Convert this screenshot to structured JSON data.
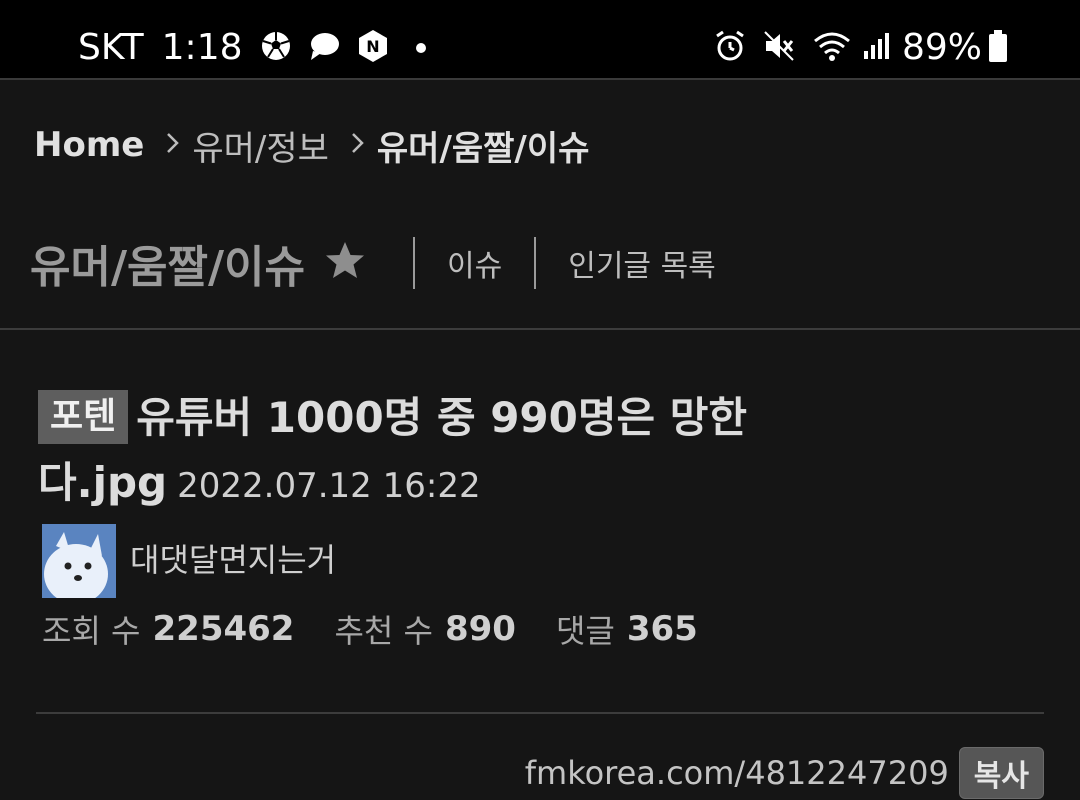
{
  "status_bar": {
    "carrier": "SKT",
    "time": "1:18",
    "battery_percent": "89%"
  },
  "breadcrumb": {
    "home": "Home",
    "section": "유머/정보",
    "current": "유머/움짤/이슈"
  },
  "board": {
    "title": "유머/움짤/이슈",
    "links": [
      "이슈",
      "인기글 목록"
    ]
  },
  "post": {
    "category": "포텐",
    "title": "유튜버 1000명 중 990명은 망한다.jpg",
    "date": "2022.07.12 16:22",
    "author": "대댓달면지는거",
    "stats": {
      "views_label": "조회 수",
      "views": "225462",
      "recommends_label": "추천 수",
      "recommends": "890",
      "comments_label": "댓글",
      "comments": "365"
    },
    "url": "fmkorea.com/4812247209",
    "copy_label": "복사"
  },
  "colors": {
    "background": "#151515",
    "status_bar": "#000000",
    "category_badge": "#5e5e5e",
    "copy_button": "#565656"
  },
  "icons": [
    "soccer-ball-icon",
    "chat-bubble-icon",
    "naver-icon",
    "dot-icon",
    "alarm-icon",
    "mute-icon",
    "wifi-icon",
    "signal-icon",
    "battery-icon",
    "chevron-right-icon",
    "star-icon"
  ]
}
